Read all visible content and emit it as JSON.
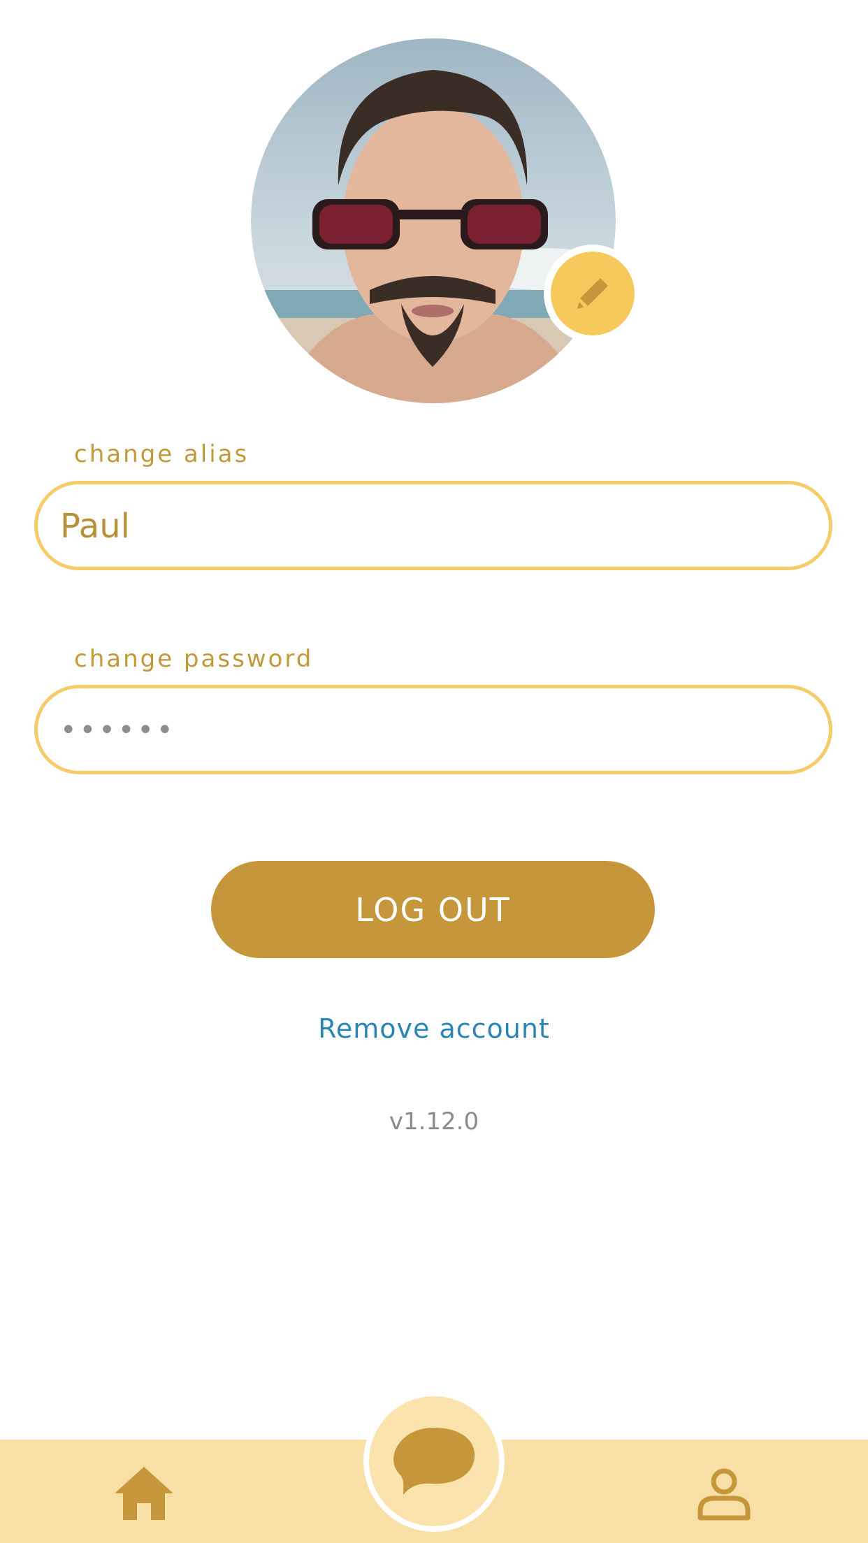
{
  "profile": {
    "avatar_alt": "profile photo",
    "edit_icon": "pencil-icon"
  },
  "alias": {
    "label": "change alias",
    "value": "Paul"
  },
  "password": {
    "label": "change password",
    "value": "••••••"
  },
  "actions": {
    "logout_label": "LOG OUT",
    "remove_label": "Remove account"
  },
  "version": "v1.12.0",
  "tabbar": {
    "items": [
      {
        "icon": "home-icon"
      },
      {
        "icon": "chat-bubble-icon"
      },
      {
        "icon": "user-icon"
      }
    ]
  },
  "colors": {
    "accent": "#C6963A",
    "field_border": "#F6CC6A",
    "badge": "#F6C95C",
    "link": "#2A86B6",
    "tabbar_bg": "#F8DFA5"
  }
}
